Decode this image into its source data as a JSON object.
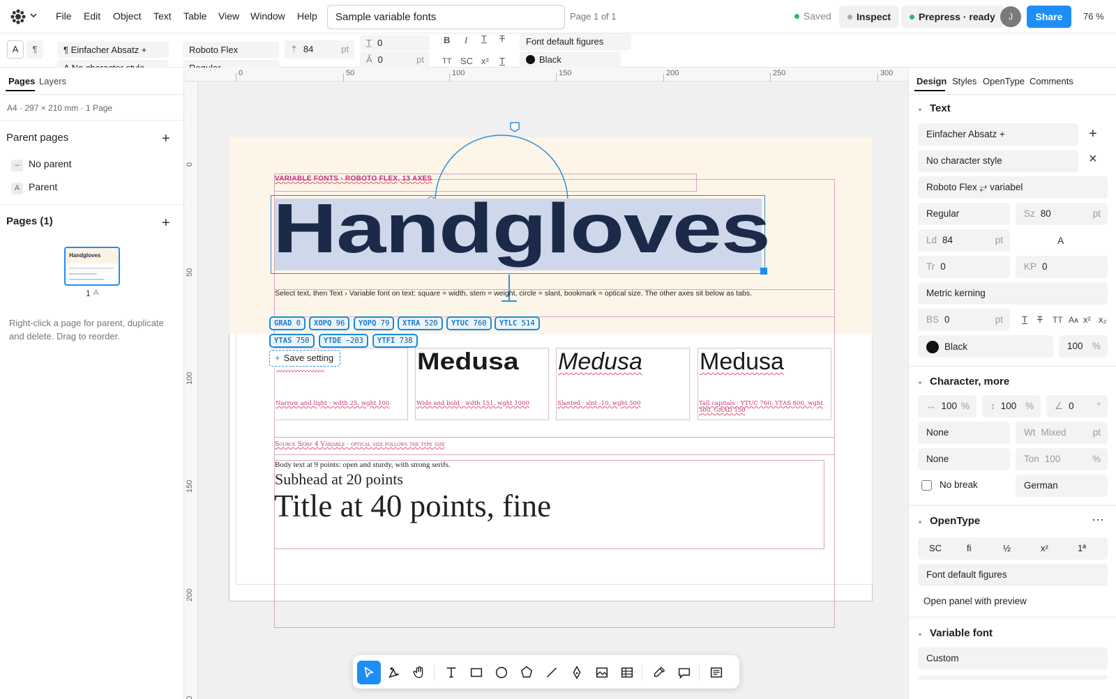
{
  "topbar": {
    "menu": [
      "File",
      "Edit",
      "Object",
      "Text",
      "Table",
      "View",
      "Window",
      "Help"
    ],
    "doc_title": "Sample variable fonts",
    "page_indicator": "Page 1 of 1",
    "saved": "Saved",
    "inspect": "Inspect",
    "prepress": "Prepress · ready",
    "avatar": "J",
    "share": "Share",
    "zoom": "76 %"
  },
  "format_bar": {
    "mode_a": "A",
    "mode_para": "¶",
    "paragraph_style": "¶ Einfacher Absatz +",
    "character_style": "A No character style",
    "font_family": "Roboto Flex",
    "font_style": "Regular",
    "leading_value": "84",
    "leading_unit": "pt",
    "baseline_value": "0",
    "tracking_value": "0",
    "tracking_unit": "pt",
    "bold": "B",
    "italic": "I",
    "small_caps_1": "TT",
    "small_caps_2": "SC",
    "superscript": "x²",
    "figures": "Font default figures",
    "color_name": "Black"
  },
  "left_panel": {
    "tab_pages": "Pages",
    "tab_layers": "Layers",
    "doc_info": "A4 · 297 × 210 mm · 1 Page",
    "parent_pages_title": "Parent pages",
    "parents": [
      {
        "badge": "–",
        "label": "No parent"
      },
      {
        "badge": "A",
        "label": "Parent"
      }
    ],
    "pages_title": "Pages (1)",
    "thumb_title": "Handgloves",
    "thumb_label": "1",
    "thumb_parent": "A",
    "hint": "Right-click a page for parent, duplicate and delete. Drag to reorder."
  },
  "rulers": {
    "top": [
      "0",
      "50",
      "100",
      "150",
      "200",
      "250",
      "300"
    ],
    "left": [
      "0",
      "50",
      "100",
      "150",
      "200",
      "250"
    ]
  },
  "canvas": {
    "kicker": "VARIABLE FONTS · ROBOTO FLEX, 13 AXES",
    "headline": "Handgloves",
    "instruction": "Select text, then Text › Variable font on text: square = width, stem = weight, circle = slant, bookmark = optical size. The other axes sit below as tabs.",
    "axis_tags": [
      {
        "axis": "GRAD",
        "value": "0"
      },
      {
        "axis": "XOPQ",
        "value": "96"
      },
      {
        "axis": "YOPQ",
        "value": "79"
      },
      {
        "axis": "XTRA",
        "value": "520"
      },
      {
        "axis": "YTUC",
        "value": "760"
      },
      {
        "axis": "YTLC",
        "value": "514"
      },
      {
        "axis": "YTAS",
        "value": "750"
      },
      {
        "axis": "YTDE",
        "value": "−203"
      },
      {
        "axis": "YTFI",
        "value": "738"
      }
    ],
    "save_setting": "Save setting",
    "samples": [
      {
        "word": "Medusa",
        "caption": "Narrow and light · wdth 25, wght 100"
      },
      {
        "word": "Medusa",
        "caption": "Wide and bold · wdth 151, wght 1000"
      },
      {
        "word": "Medusa",
        "caption": "Slanted · slnt -10, wght 500"
      },
      {
        "word": "Medusa",
        "caption": "Tall capitals · YTUC 760, YTAS 800, wght 300, GRAD 150"
      }
    ],
    "serif_label": "Source Serif 4 Variable · optical size follows the type size",
    "body_text": "Body text at 9 points: open and sturdy, with strong serifs.",
    "subhead": "Subhead at 20 points",
    "title_text": "Title at 40 points, fine"
  },
  "right_panel": {
    "tabs": [
      "Design",
      "Styles",
      "OpenType",
      "Comments"
    ],
    "text_section": "Text",
    "paragraph_style": "Einfacher Absatz +",
    "character_style": "No character style",
    "font": "Roboto Flex ⥂ variabel",
    "style": "Regular",
    "size_label": "Sz",
    "size_value": "80",
    "unit_pt": "pt",
    "leading_label": "Ld",
    "leading_value": "84",
    "auto_a": "A",
    "tracking_label": "Tr",
    "tracking_value": "0",
    "kp_label": "KP",
    "kp_value": "0",
    "kerning": "Metric kerning",
    "bs_label": "BS",
    "bs_value": "0",
    "color_name": "Black",
    "opacity": "100",
    "opacity_unit": "%",
    "char_more_section": "Character, more",
    "h_scale": "100",
    "v_scale": "100",
    "skew": "0",
    "pct": "%",
    "deg": "°",
    "none_1": "None",
    "wt_label": "Wt",
    "wt_value": "Mixed",
    "none_2": "None",
    "ton_label": "Ton",
    "ton_value": "100",
    "no_break": "No break",
    "language": "German",
    "opentype_section": "OpenType",
    "ot_buttons": [
      "SC",
      "fi",
      "½",
      "x²",
      "1ª"
    ],
    "figures": "Font default figures",
    "open_panel": "Open panel with preview",
    "variable_section": "Variable font",
    "variable_value": "Custom"
  },
  "colors": {
    "accent": "#1e8ef7",
    "headline": "#1c2a4a",
    "selection": "#cfd8ea",
    "guide_pink": "#c4307a",
    "tag_blue": "#1a8ad6"
  }
}
